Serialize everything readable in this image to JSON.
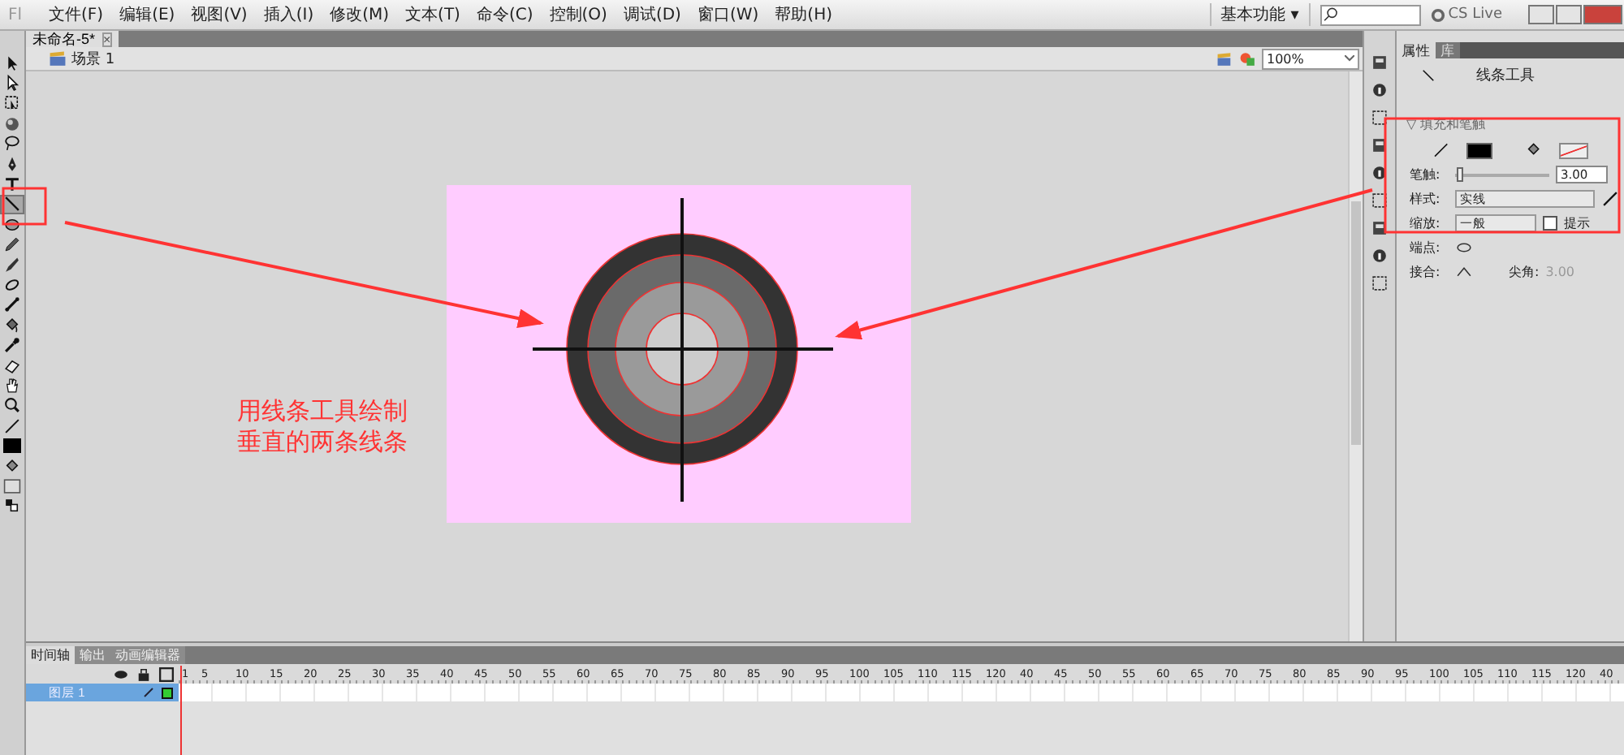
{
  "app_logo": "Fl",
  "menu": [
    "文件(F)",
    "编辑(E)",
    "视图(V)",
    "插入(I)",
    "修改(M)",
    "文本(T)",
    "命令(C)",
    "控制(O)",
    "调试(D)",
    "窗口(W)",
    "帮助(H)"
  ],
  "workspace": {
    "label": "基本功能",
    "caret": "▾"
  },
  "cs_live": "CS Live",
  "document_tab": {
    "title": "未命名-5*",
    "close": "×"
  },
  "scene": "场景 1",
  "zoom": "100%",
  "tools": [
    {
      "selected": false
    },
    {
      "selected": false
    },
    {
      "selected": false
    },
    {
      "selected": false
    },
    {
      "selected": false
    },
    {
      "selected": false
    },
    {
      "selected": false
    },
    {
      "selected": true
    },
    {
      "selected": false
    },
    {
      "selected": false
    },
    {
      "selected": false
    },
    {
      "selected": false
    },
    {
      "selected": false
    },
    {
      "selected": false
    },
    {
      "selected": false
    },
    {
      "selected": false
    },
    {
      "selected": false
    },
    {
      "selected": false
    },
    {
      "selected": false
    },
    {
      "selected": false
    },
    {
      "selected": false
    },
    {
      "selected": false
    },
    {
      "selected": false
    }
  ],
  "annotation": {
    "lines": [
      "用线条工具绘制",
      "垂直的两条线条"
    ]
  },
  "properties": {
    "tabs": [
      {
        "label": "属性",
        "selected": true
      },
      {
        "label": "库",
        "selected": false
      }
    ],
    "tool_name": "线条工具",
    "section_toggle": "▽",
    "section": "填充和笔触",
    "stroke_label": "笔触:",
    "stroke_width": {
      "level": 0.02
    },
    "stroke_value": "3.00",
    "style_label": "样式:",
    "style_value": "实线",
    "scale_label": "缩放:",
    "scale_value": "一般",
    "hint": {
      "label": "提示",
      "checked": false
    },
    "cap_label": "端点:",
    "join_label": "接合:",
    "miter_label": "尖角:",
    "miter_value": "3.00"
  },
  "timeline": {
    "tabs": [
      {
        "label": "时间轴",
        "selected": true
      },
      {
        "label": "输出",
        "selected": false
      },
      {
        "label": "动画编辑器",
        "selected": false
      }
    ],
    "ruler": [
      "1",
      "5",
      "10",
      "15",
      "20",
      "25",
      "30",
      "35",
      "40",
      "45",
      "50",
      "55",
      "60",
      "65",
      "70",
      "75",
      "80",
      "85",
      "90",
      "95",
      "100",
      "105",
      "110",
      "115",
      "120",
      "40",
      "45",
      "50",
      "55",
      "60",
      "65",
      "70",
      "75",
      "80",
      "85",
      "90",
      "95",
      "100",
      "105",
      "110",
      "115",
      "120",
      "40"
    ],
    "layers": [
      {
        "name": "图层 1",
        "selected": true
      }
    ]
  }
}
